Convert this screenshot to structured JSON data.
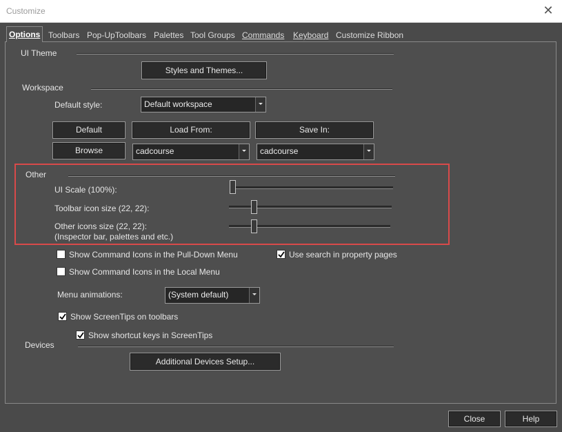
{
  "window": {
    "title": "Customize",
    "close_glyph": "✕"
  },
  "tabs": [
    {
      "label": "Options",
      "active": true
    },
    {
      "label": "Toolbars"
    },
    {
      "label": "Pop-UpToolbars"
    },
    {
      "label": "Palettes"
    },
    {
      "label": "Tool Groups"
    },
    {
      "label": "Commands"
    },
    {
      "label": "Keyboard"
    },
    {
      "label": "Customize Ribbon"
    }
  ],
  "ui_theme": {
    "label": "UI Theme",
    "styles_button": "Styles and Themes..."
  },
  "workspace": {
    "label": "Workspace",
    "default_style_label": "Default style:",
    "default_style_value": "Default workspace",
    "default_button": "Default",
    "load_from_button": "Load From:",
    "save_in_button": "Save In:",
    "browse_button": "Browse",
    "load_from_value": "cadcourse",
    "save_in_value": "cadcourse"
  },
  "other": {
    "label": "Other",
    "ui_scale_label": "UI Scale (100%):",
    "toolbar_icon_label": "Toolbar icon size (22, 22):",
    "other_icons_label_1": "Other icons size (22, 22):",
    "other_icons_label_2": "(Inspector bar, palettes and etc.)",
    "ui_scale_level": 0.0,
    "toolbar_icon_level": 0.14,
    "other_icons_level": 0.14
  },
  "options": {
    "show_icons_pulldown": {
      "label": "Show Command Icons in the Pull-Down Menu",
      "checked": false
    },
    "use_search": {
      "label": "Use search in property pages",
      "checked": true
    },
    "show_icons_local": {
      "label": "Show Command Icons in the Local Menu",
      "checked": false
    },
    "menu_animations_label": "Menu animations:",
    "menu_animations_value": "(System default)",
    "show_screentips": {
      "label": "Show ScreenTips on toolbars",
      "checked": true
    },
    "show_shortcut_keys": {
      "label": "Show shortcut keys in ScreenTips",
      "checked": true
    }
  },
  "devices": {
    "label": "Devices",
    "setup_button": "Additional Devices Setup..."
  },
  "footer": {
    "close_button": "Close",
    "help_button": "Help"
  },
  "colors": {
    "background": "#4a4a4a",
    "button": "#2b2b2b",
    "highlight": "#d94a4a"
  }
}
